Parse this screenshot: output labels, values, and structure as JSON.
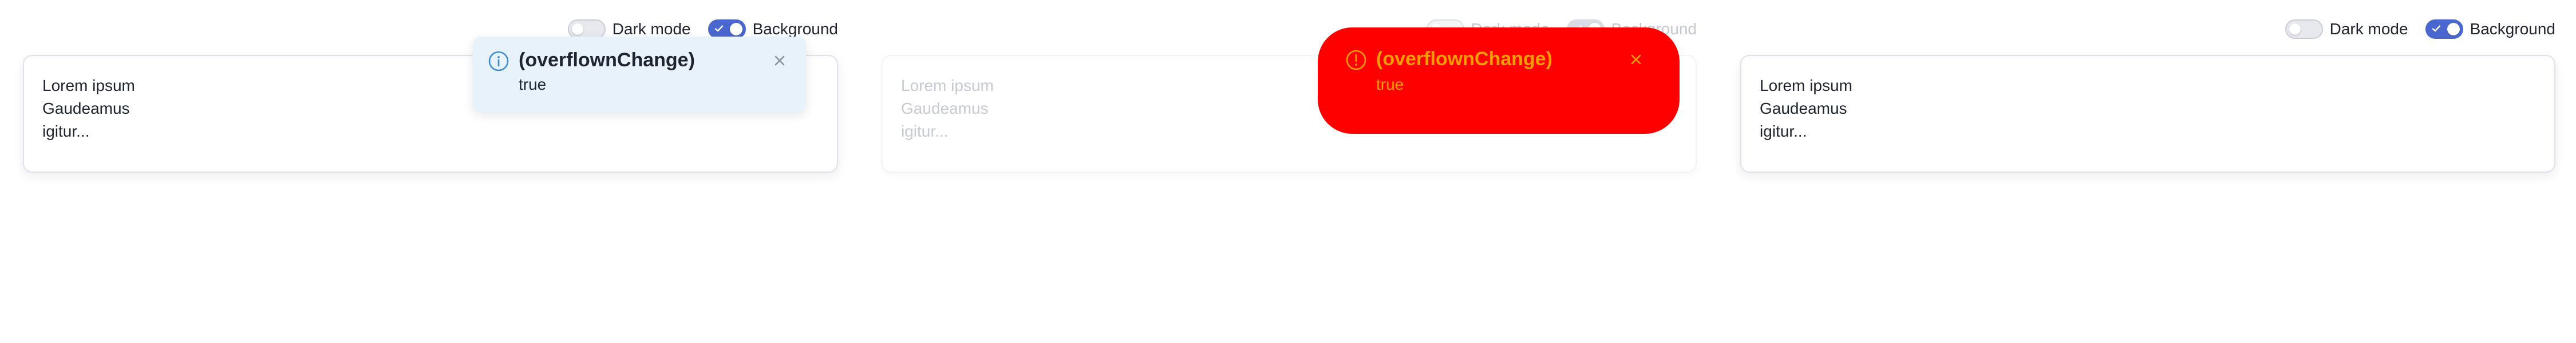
{
  "panels": [
    {
      "toggles": {
        "dark_mode": {
          "label": "Dark mode",
          "checked": false
        },
        "background": {
          "label": "Background",
          "checked": true
        }
      },
      "card": {
        "lines": [
          "Lorem ipsum",
          "Gaudeamus",
          "igitur..."
        ]
      },
      "toast": {
        "variant": "info",
        "icon": "info-icon",
        "title": "(overflownChange)",
        "message": "true",
        "close_icon": "close-icon"
      }
    },
    {
      "toggles": {
        "dark_mode": {
          "label": "Dark mode",
          "checked": false
        },
        "background": {
          "label": "Background",
          "checked": true
        }
      },
      "card": {
        "lines": [
          "Lorem ipsum",
          "Gaudeamus",
          "igitur..."
        ]
      },
      "toast": {
        "variant": "error",
        "icon": "alert-circle-icon",
        "title": "(overflownChange)",
        "message": "true",
        "close_icon": "close-icon"
      }
    },
    {
      "toggles": {
        "dark_mode": {
          "label": "Dark mode",
          "checked": false
        },
        "background": {
          "label": "Background",
          "checked": true
        }
      },
      "card": {
        "lines": [
          "Lorem ipsum",
          "Gaudeamus",
          "igitur..."
        ]
      }
    }
  ],
  "colors": {
    "accent": "#4a67cf",
    "toast_info_bg": "#e8f2fb",
    "toast_info_icon": "#3e8ed0",
    "toast_error_bg": "#ff0000",
    "toast_error_text": "#ff9d00",
    "text": "#1f2430"
  }
}
